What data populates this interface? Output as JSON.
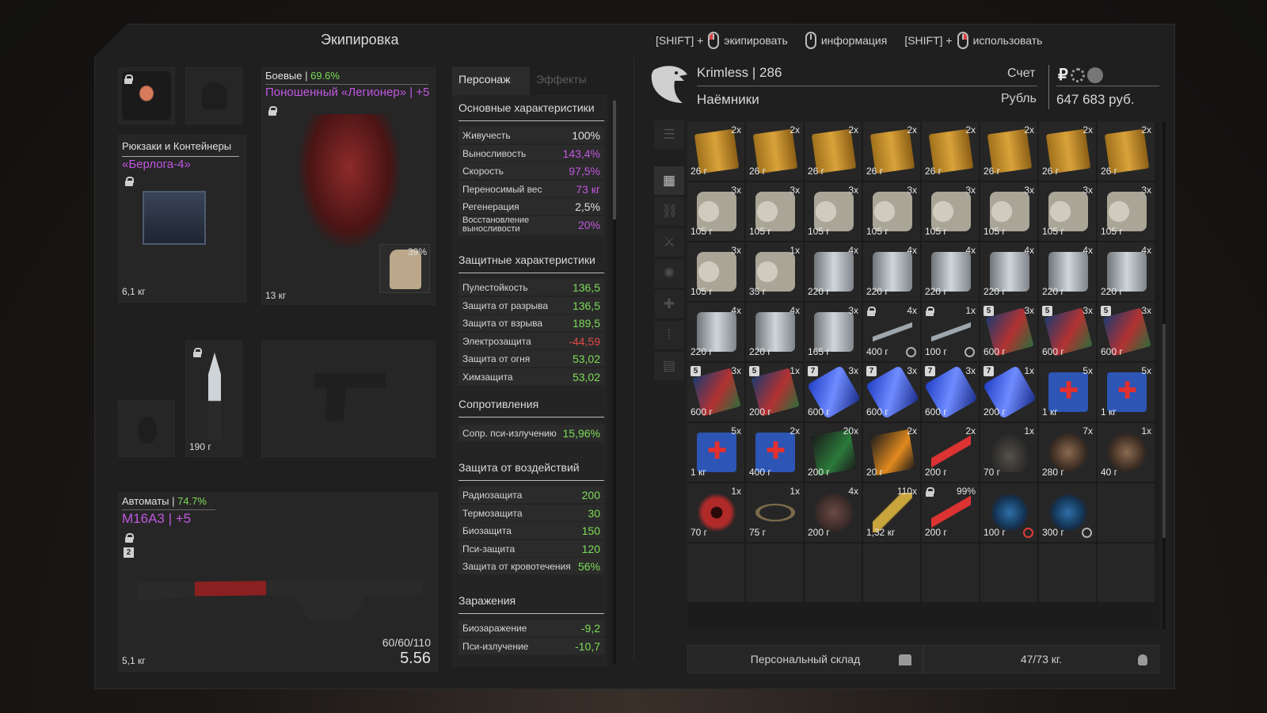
{
  "title": "Экипировка",
  "hints": [
    {
      "prefix": "[SHIFT] +",
      "mouse": "left",
      "label": "экипировать"
    },
    {
      "prefix": "",
      "mouse": "mid",
      "label": "информация"
    },
    {
      "prefix": "[SHIFT] +",
      "mouse": "right",
      "label": "использовать"
    }
  ],
  "equipment": {
    "backpack": {
      "title": "Рюкзаки и Контейнеры",
      "name": "«Берлога-4»",
      "weight": "6,1 кг"
    },
    "armor": {
      "category": "Боевые",
      "percent": "69.6%",
      "name": "Поношенный «Легионер» | +5",
      "weight": "13 кг",
      "plate_pct": "39%"
    },
    "knife": {
      "weight": "190 г"
    },
    "weapon": {
      "category": "Автоматы",
      "percent": "74.7%",
      "name": "M16A3 | +5",
      "slot_num": "2",
      "weight": "5,1 кг",
      "ammo": "60/60/110",
      "caliber": "5.56"
    }
  },
  "stats": {
    "tabs": [
      "Персонаж",
      "Эффекты"
    ],
    "main_title": "Основные характеристики",
    "main": [
      {
        "k": "Живучесть",
        "v": "100%",
        "c": "#e0e0e0"
      },
      {
        "k": "Выносливость",
        "v": "143,4%",
        "c": "#c158e0"
      },
      {
        "k": "Скорость",
        "v": "97,5%",
        "c": "#c158e0"
      },
      {
        "k": "Переносимый вес",
        "v": "73 кг",
        "c": "#c158e0"
      },
      {
        "k": "Регенерация",
        "v": "2,5%",
        "c": "#e0e0e0"
      },
      {
        "k": "Восстановление выносливости",
        "v": "20%",
        "c": "#c158e0"
      }
    ],
    "prot_title": "Защитные характеристики",
    "prot": [
      {
        "k": "Пулестойкость",
        "v": "136,5",
        "c": "#7ddc57"
      },
      {
        "k": "Защита от разрыва",
        "v": "136,5",
        "c": "#7ddc57"
      },
      {
        "k": "Защита от взрыва",
        "v": "189,5",
        "c": "#7ddc57"
      },
      {
        "k": "Электрозащита",
        "v": "-44,59",
        "c": "#e04848"
      },
      {
        "k": "Защита от огня",
        "v": "53,02",
        "c": "#7ddc57"
      },
      {
        "k": "Химзащита",
        "v": "53,02",
        "c": "#7ddc57"
      }
    ],
    "res_title": "Сопротивления",
    "res": [
      {
        "k": "Сопр. пси-излучению",
        "v": "15,96%",
        "c": "#7ddc57"
      }
    ],
    "imp_title": "Защита от воздействий",
    "imp": [
      {
        "k": "Радиозащита",
        "v": "200",
        "c": "#7ddc57"
      },
      {
        "k": "Термозащита",
        "v": "30",
        "c": "#7ddc57"
      },
      {
        "k": "Биозащита",
        "v": "150",
        "c": "#7ddc57"
      },
      {
        "k": "Пси-защита",
        "v": "120",
        "c": "#7ddc57"
      },
      {
        "k": "Защита от кровотечения",
        "v": "56%",
        "c": "#7ddc57"
      }
    ],
    "inf_title": "Заражения",
    "inf": [
      {
        "k": "Биозаражение",
        "v": "-9,2",
        "c": "#7ddc57"
      },
      {
        "k": "Пси-излучение",
        "v": "-10,7",
        "c": "#7ddc57"
      }
    ]
  },
  "player": {
    "name": "Krimless",
    "level": "286",
    "faction": "Наёмники",
    "account_label": "Счет",
    "currency": "Рубль",
    "money": "647 683 руб."
  },
  "inventory": [
    {
      "a": "lighter",
      "c": "2x",
      "w": "26 г"
    },
    {
      "a": "lighter",
      "c": "2x",
      "w": "26 г"
    },
    {
      "a": "lighter",
      "c": "2x",
      "w": "26 г"
    },
    {
      "a": "lighter",
      "c": "2x",
      "w": "26 г"
    },
    {
      "a": "lighter",
      "c": "2x",
      "w": "26 г"
    },
    {
      "a": "lighter",
      "c": "2x",
      "w": "26 г"
    },
    {
      "a": "lighter",
      "c": "2x",
      "w": "26 г"
    },
    {
      "a": "lighter",
      "c": "2x",
      "w": "26 г"
    },
    {
      "a": "roll",
      "c": "3x",
      "w": "105 г"
    },
    {
      "a": "roll",
      "c": "3x",
      "w": "105 г"
    },
    {
      "a": "roll",
      "c": "3x",
      "w": "105 г"
    },
    {
      "a": "roll",
      "c": "3x",
      "w": "105 г"
    },
    {
      "a": "roll",
      "c": "3x",
      "w": "105 г"
    },
    {
      "a": "roll",
      "c": "3x",
      "w": "105 г"
    },
    {
      "a": "roll",
      "c": "3x",
      "w": "105 г"
    },
    {
      "a": "roll",
      "c": "3x",
      "w": "105 г"
    },
    {
      "a": "roll",
      "c": "3x",
      "w": "105 г"
    },
    {
      "a": "roll",
      "c": "1x",
      "w": "35 г"
    },
    {
      "a": "can",
      "c": "4x",
      "w": "220 г"
    },
    {
      "a": "can",
      "c": "4x",
      "w": "220 г"
    },
    {
      "a": "can",
      "c": "4x",
      "w": "220 г"
    },
    {
      "a": "can",
      "c": "4x",
      "w": "220 г"
    },
    {
      "a": "can",
      "c": "4x",
      "w": "220 г"
    },
    {
      "a": "can",
      "c": "4x",
      "w": "220 г"
    },
    {
      "a": "can",
      "c": "4x",
      "w": "220 г"
    },
    {
      "a": "can",
      "c": "4x",
      "w": "220 г"
    },
    {
      "a": "can",
      "c": "3x",
      "w": "165 г"
    },
    {
      "a": "knife",
      "c": "4x",
      "w": "400 г",
      "lock": true,
      "t": "gray"
    },
    {
      "a": "knife",
      "c": "1x",
      "w": "100 г",
      "lock": true,
      "t": "gray"
    },
    {
      "a": "pack",
      "c": "3x",
      "w": "600 г",
      "l": "5"
    },
    {
      "a": "pack",
      "c": "3x",
      "w": "600 г",
      "l": "5"
    },
    {
      "a": "pack",
      "c": "3x",
      "w": "600 г",
      "l": "5"
    },
    {
      "a": "pack",
      "c": "3x",
      "w": "600 г",
      "l": "5"
    },
    {
      "a": "pack",
      "c": "1x",
      "w": "200 г",
      "l": "5"
    },
    {
      "a": "blue",
      "c": "3x",
      "w": "600 г",
      "l": "7"
    },
    {
      "a": "blue",
      "c": "3x",
      "w": "600 г",
      "l": "7"
    },
    {
      "a": "blue",
      "c": "3x",
      "w": "600 г",
      "l": "7"
    },
    {
      "a": "blue",
      "c": "1x",
      "w": "200 г",
      "l": "7"
    },
    {
      "a": "med",
      "c": "5x",
      "w": "1 кг"
    },
    {
      "a": "med",
      "c": "5x",
      "w": "1 кг"
    },
    {
      "a": "med",
      "c": "5x",
      "w": "1 кг"
    },
    {
      "a": "med",
      "c": "2x",
      "w": "400 г"
    },
    {
      "a": "bbox",
      "c": "20x",
      "w": "200 г"
    },
    {
      "a": "obox",
      "c": "2x",
      "w": "20 г"
    },
    {
      "a": "syr",
      "c": "2x",
      "w": "200 г"
    },
    {
      "a": "feather",
      "c": "1x",
      "w": "70 г"
    },
    {
      "a": "claw",
      "c": "7x",
      "w": "280 г"
    },
    {
      "a": "claw",
      "c": "1x",
      "w": "40 г"
    },
    {
      "a": "eye",
      "c": "1x",
      "w": "70 г"
    },
    {
      "a": "ring",
      "c": "1x",
      "w": "75 г"
    },
    {
      "a": "head",
      "c": "4x",
      "w": "200 г"
    },
    {
      "a": "ammo",
      "c": "110x",
      "w": "1,32 кг"
    },
    {
      "a": "syr",
      "c": "99%",
      "w": "200 г",
      "lock": true
    },
    {
      "a": "orb",
      "c": "",
      "w": "100 г",
      "t": "red"
    },
    {
      "a": "orb",
      "c": "",
      "w": "300 г",
      "t": "gray"
    },
    {
      "a": "",
      "c": "",
      "w": ""
    },
    {
      "a": "",
      "c": "",
      "w": ""
    },
    {
      "a": "",
      "c": "",
      "w": ""
    },
    {
      "a": "",
      "c": "",
      "w": ""
    },
    {
      "a": "",
      "c": "",
      "w": ""
    },
    {
      "a": "",
      "c": "",
      "w": ""
    },
    {
      "a": "",
      "c": "",
      "w": ""
    },
    {
      "a": "",
      "c": "",
      "w": ""
    },
    {
      "a": "",
      "c": "",
      "w": ""
    }
  ],
  "footer": {
    "storage": "Персональный склад",
    "weight": "47/73 кг."
  }
}
